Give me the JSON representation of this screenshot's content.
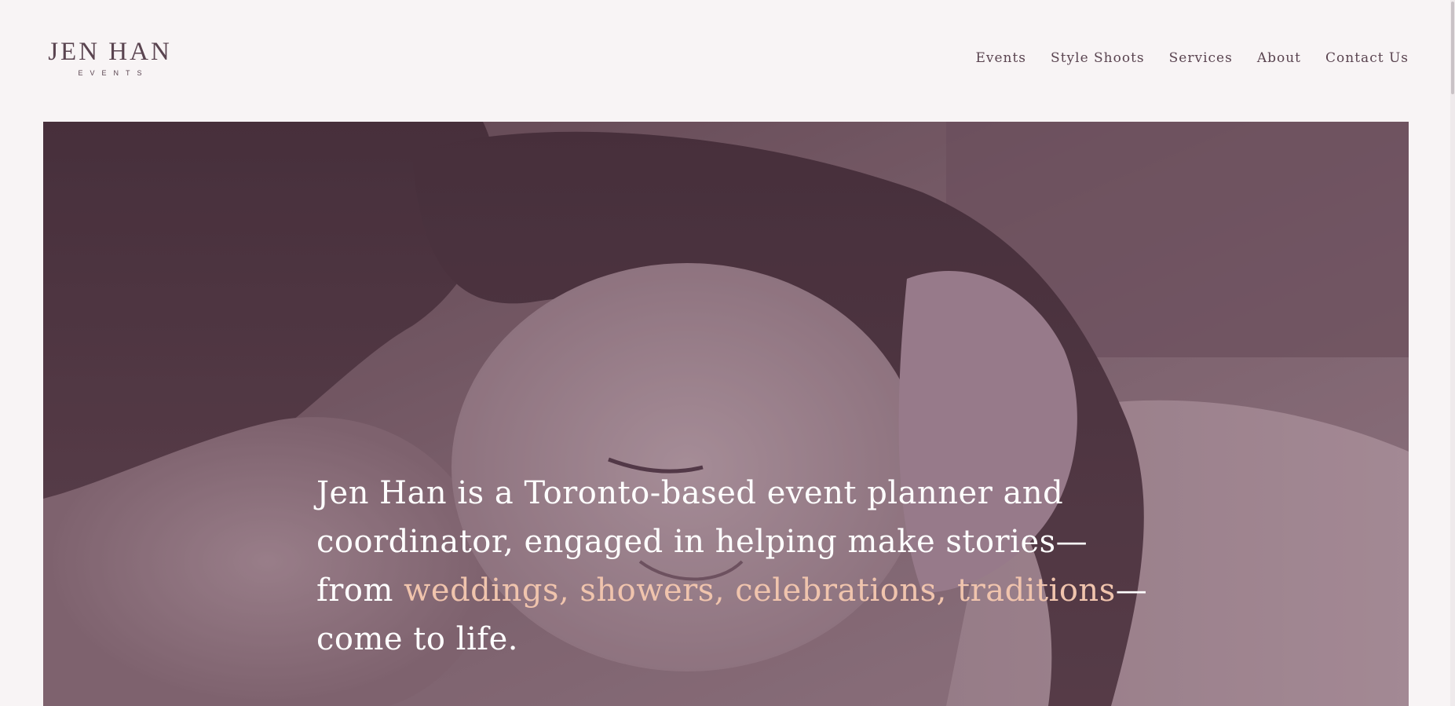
{
  "brand": {
    "name": "JEN HAN",
    "tagline": "EVENTS"
  },
  "nav": {
    "items": [
      {
        "label": "Events"
      },
      {
        "label": "Style Shoots"
      },
      {
        "label": "Services"
      },
      {
        "label": "About"
      },
      {
        "label": "Contact Us"
      }
    ]
  },
  "hero": {
    "text_before": "Jen Han is a Toronto-based event planner and coordinator, engaged in helping make stories— from ",
    "text_highlight": "weddings, showers, celebrations, traditions",
    "text_after": "— come to life."
  },
  "colors": {
    "background": "#f8f4f5",
    "nav_text": "#5a4450",
    "hero_overlay": "#7d616d",
    "hero_text": "#ffffff",
    "accent": "#f0c4ad"
  }
}
